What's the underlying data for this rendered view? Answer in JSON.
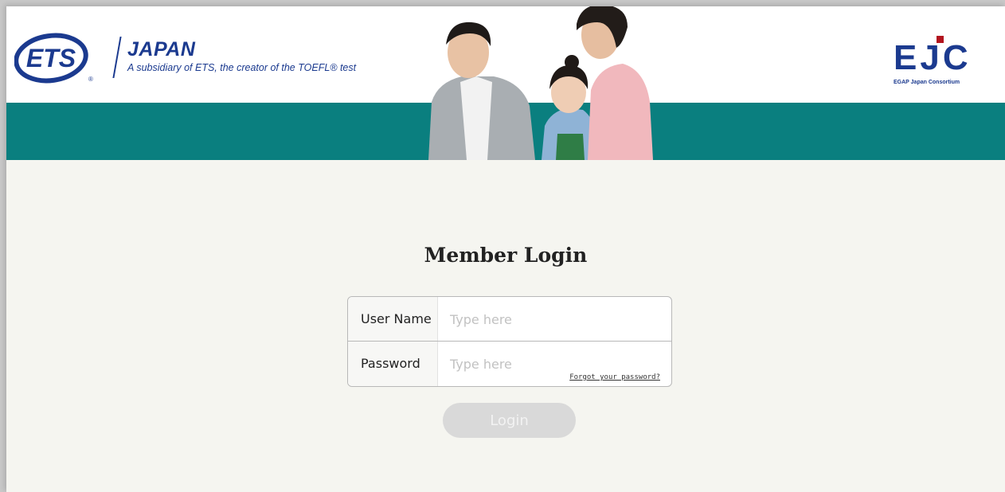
{
  "header": {
    "ets_logo_text": "ETS",
    "japan_title": "JAPAN",
    "japan_subtitle": "A subsidiary of ETS, the creator of the TOEFL® test",
    "ejc_logo_text": "EJC",
    "ejc_caption": "EGAP Japan Consortium"
  },
  "login": {
    "title": "Member Login",
    "username_label": "User Name",
    "username_placeholder": "Type here",
    "password_label": "Password",
    "password_placeholder": "Type here",
    "forgot_link": "Forgot your password?",
    "login_button": "Login"
  },
  "colors": {
    "brand_blue": "#1b3a8f",
    "teal_band": "#0a7f7f",
    "ejc_accent": "#b2141e",
    "page_bg": "#f5f5f0",
    "button_disabled": "#d9d9d9"
  }
}
